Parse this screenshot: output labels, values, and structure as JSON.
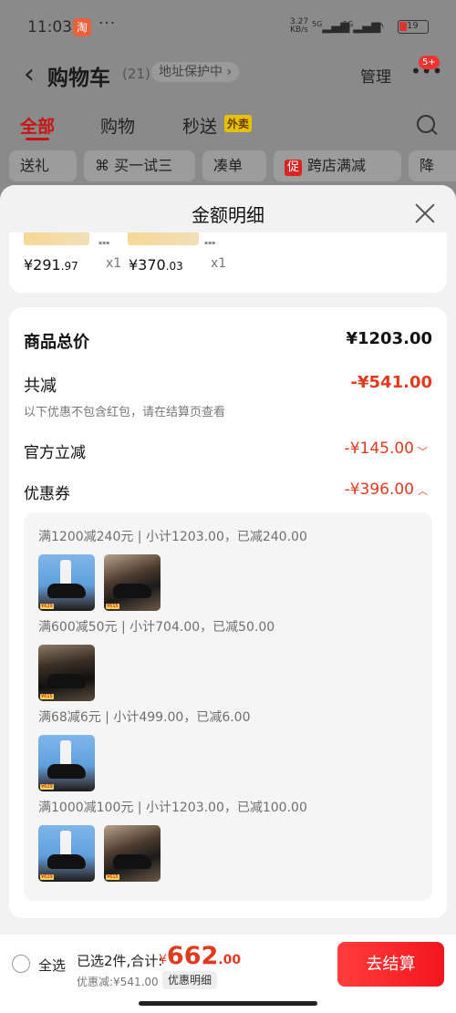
{
  "status_bar": {
    "time": "11:03",
    "app_icon": "淘",
    "more": "···",
    "net_speed": "3.27",
    "net_unit": "KB/s",
    "signal1": "5G",
    "signal2": "5G",
    "battery": "19"
  },
  "header": {
    "back_icon": "chevron-left-icon",
    "title": "购物车",
    "count": "(21)",
    "address_protect": "地址保护中 ›",
    "manage": "管理",
    "more_badge": "5+"
  },
  "tabs": [
    {
      "label": "全部",
      "active": true
    },
    {
      "label": "购物"
    },
    {
      "label": "秒送"
    }
  ],
  "waimai_tag": "外卖",
  "chips": [
    "送礼",
    "买一试三",
    "凑单",
    "跨店满减",
    "降"
  ],
  "chip_promo_tag": "促",
  "sheet": {
    "title": "金额明细",
    "items": [
      {
        "price_int": "¥291",
        "price_dec": ".97",
        "qty": "x1"
      },
      {
        "price_int": "¥370",
        "price_dec": ".03",
        "qty": "x1"
      }
    ],
    "total_label": "商品总价",
    "total_value": "¥1203.00",
    "reduce_label": "共减",
    "reduce_value": "-¥541.00",
    "reduce_note": "以下优惠不包含红包，请在结算页查看",
    "official_label": "官方立减",
    "official_value": "-¥145.00",
    "coupon_label": "优惠券",
    "coupon_value": "-¥396.00",
    "rules": [
      "满1200减240元 | 小计1203.00，已减240.00",
      "满600减50元 | 小计704.00，已减50.00",
      "满68减6元 | 小计499.00，已减6.00",
      "满1000减100元 | 小计1203.00，已减100.00"
    ]
  },
  "bottom_bar": {
    "select_all": "全选",
    "summary": "已选2件,合计:",
    "currency": "¥",
    "total_big": "662",
    "total_dec": ".00",
    "discount": "优惠减:¥541.00",
    "detail_button": "优惠明细",
    "checkout": "去结算"
  },
  "colors": {
    "accent_red": "#e03b1f",
    "tab_red": "#c91313",
    "checkout": "#f2161d"
  }
}
